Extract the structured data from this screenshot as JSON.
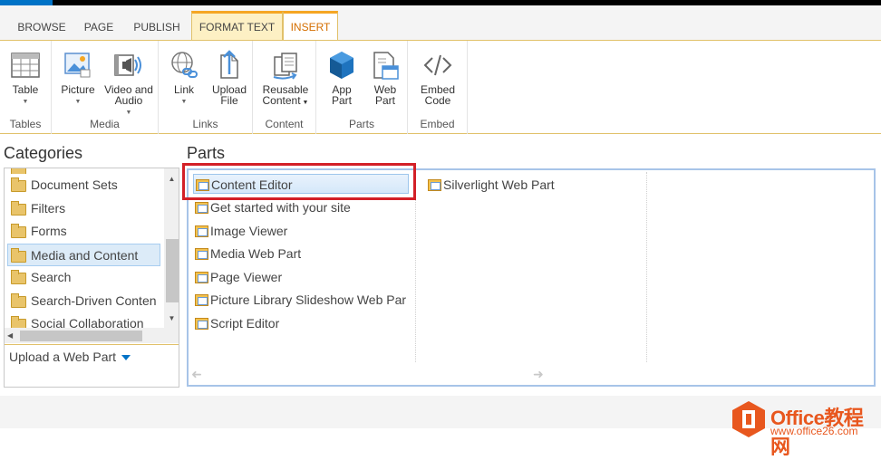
{
  "ribbon_tabs": [
    "BROWSE",
    "PAGE",
    "PUBLISH",
    "FORMAT TEXT",
    "INSERT"
  ],
  "ribbon": {
    "groups": {
      "tables": "Tables",
      "media": "Media",
      "links": "Links",
      "content": "Content",
      "parts": "Parts",
      "embed": "Embed"
    },
    "buttons": {
      "table": [
        "Table",
        ""
      ],
      "picture": [
        "Picture",
        ""
      ],
      "video": [
        "Video and",
        "Audio"
      ],
      "link": [
        "Link",
        ""
      ],
      "upload": [
        "Upload",
        "File"
      ],
      "reusable": [
        "Reusable",
        "Content"
      ],
      "app_part": [
        "App",
        "Part"
      ],
      "web_part": [
        "Web",
        "Part"
      ],
      "embed": [
        "Embed",
        "Code"
      ]
    },
    "accent": "#f5a623",
    "active_tab_color": "#d46e00"
  },
  "categories": {
    "title": "Categories",
    "items": [
      "Document Sets",
      "Filters",
      "Forms",
      "Media and Content",
      "Search",
      "Search-Driven Conten",
      "Social Collaboration"
    ],
    "selected": "Media and Content",
    "upload_label": "Upload a Web Part"
  },
  "parts": {
    "title": "Parts",
    "column1": [
      "Content Editor",
      "Get started with your site",
      "Image Viewer",
      "Media Web Part",
      "Page Viewer",
      "Picture Library Slideshow Web Par",
      "Script Editor"
    ],
    "column2": [
      "Silverlight Web Part"
    ],
    "selected": "Content Editor"
  },
  "watermark": {
    "brand": "Office教程网",
    "url": "www.office26.com"
  }
}
